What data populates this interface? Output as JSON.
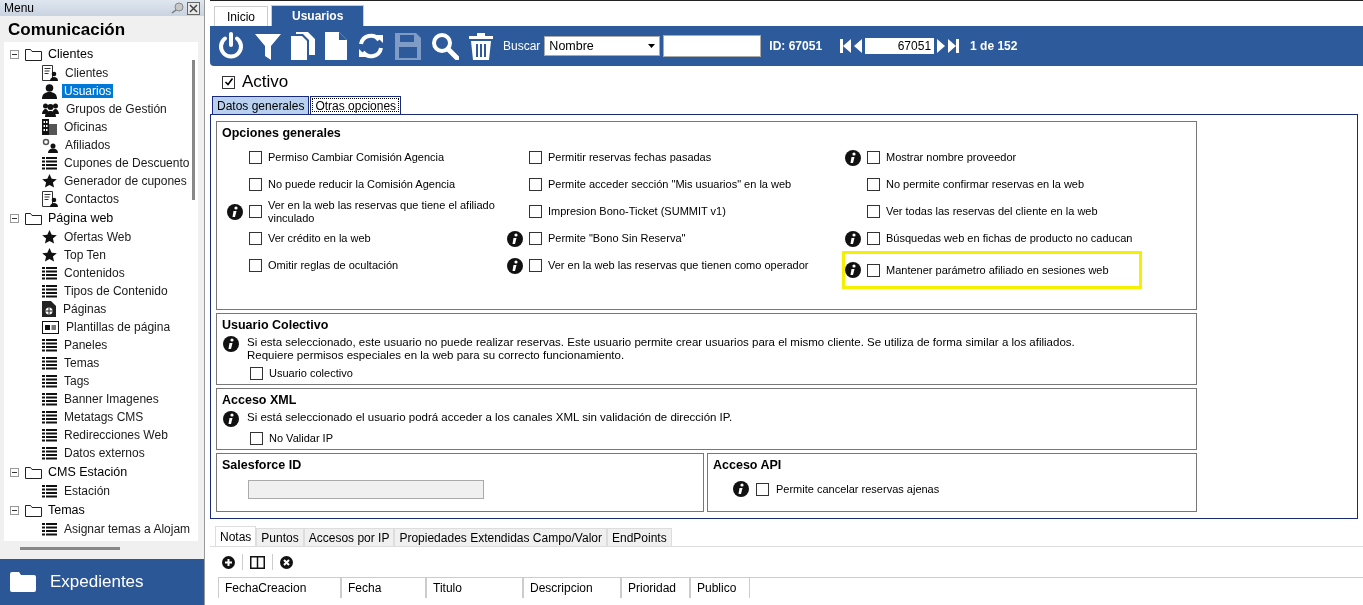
{
  "sidebar": {
    "header": "Menu",
    "title": "Comunicación",
    "tree": [
      {
        "label": "Clientes",
        "expanded": true,
        "children": [
          {
            "label": "Clientes",
            "kind": "contact",
            "selected": false
          },
          {
            "label": "Usuarios",
            "kind": "user",
            "selected": true
          },
          {
            "label": "Grupos de Gestión",
            "kind": "group",
            "selected": false
          },
          {
            "label": "Oficinas",
            "kind": "building",
            "selected": false
          },
          {
            "label": "Afiliados",
            "kind": "affiliate",
            "selected": false
          },
          {
            "label": "Cupones de Descuento",
            "kind": "list",
            "selected": false
          },
          {
            "label": "Generador de cupones",
            "kind": "star",
            "selected": false
          },
          {
            "label": "Contactos",
            "kind": "contact",
            "selected": false
          }
        ]
      },
      {
        "label": "Página web",
        "expanded": true,
        "children": [
          {
            "label": "Ofertas Web",
            "kind": "star",
            "selected": false
          },
          {
            "label": "Top Ten",
            "kind": "star",
            "selected": false
          },
          {
            "label": "Contenidos",
            "kind": "list",
            "selected": false
          },
          {
            "label": "Tipos de Contenido",
            "kind": "list",
            "selected": false
          },
          {
            "label": "Páginas",
            "kind": "page",
            "selected": false
          },
          {
            "label": "Plantillas de página",
            "kind": "template",
            "selected": false
          },
          {
            "label": "Paneles",
            "kind": "list",
            "selected": false
          },
          {
            "label": "Temas",
            "kind": "list",
            "selected": false
          },
          {
            "label": "Tags",
            "kind": "list",
            "selected": false
          },
          {
            "label": "Banner Imagenes",
            "kind": "list",
            "selected": false
          },
          {
            "label": "Metatags CMS",
            "kind": "list",
            "selected": false
          },
          {
            "label": "Redirecciones Web",
            "kind": "list",
            "selected": false
          },
          {
            "label": "Datos externos",
            "kind": "list",
            "selected": false
          }
        ]
      },
      {
        "label": "CMS Estación",
        "expanded": true,
        "children": [
          {
            "label": "Estación",
            "kind": "list",
            "selected": false
          }
        ]
      },
      {
        "label": "Temas",
        "expanded": true,
        "children": [
          {
            "label": "Asignar temas a Alojam",
            "kind": "list",
            "selected": false
          }
        ]
      }
    ],
    "footer": "Expedientes"
  },
  "tabs": [
    {
      "label": "Inicio",
      "selected": false
    },
    {
      "label": "Usuarios",
      "selected": true
    }
  ],
  "toolbar": {
    "buttons": [
      {
        "kind": "power",
        "disabled": false
      },
      {
        "kind": "filter",
        "disabled": false
      },
      {
        "kind": "copy",
        "disabled": false
      },
      {
        "kind": "new",
        "disabled": false
      },
      {
        "kind": "refresh",
        "disabled": false
      },
      {
        "kind": "save",
        "disabled": true
      },
      {
        "kind": "search",
        "disabled": false
      },
      {
        "kind": "delete",
        "disabled": false
      }
    ],
    "search_label": "Buscar",
    "search_by": "Nombre",
    "id_label": "ID: 67051",
    "record": "67051",
    "record_count": "1 de 152"
  },
  "active": {
    "label": "Activo",
    "checked": true
  },
  "subtabs": [
    {
      "label": "Datos generales",
      "selected": false
    },
    {
      "label": "Otras opciones",
      "selected": true
    }
  ],
  "general_options": {
    "title": "Opciones generales",
    "columns": [
      [
        {
          "label": "Permiso Cambiar Comisión Agencia",
          "checked": false,
          "info": false,
          "highlighted": false
        },
        {
          "label": "No puede reducir la Comisión Agencia",
          "checked": false,
          "info": false,
          "highlighted": false
        },
        {
          "label": "Ver en la web las reservas que tiene el afiliado vinculado",
          "checked": false,
          "info": true,
          "highlighted": false
        },
        {
          "label": "Ver crédito en la web",
          "checked": false,
          "info": false,
          "highlighted": false
        },
        {
          "label": "Omitir reglas de ocultación",
          "checked": false,
          "info": false,
          "highlighted": false
        }
      ],
      [
        {
          "label": "Permitir reservas fechas pasadas",
          "checked": false,
          "info": false,
          "highlighted": false
        },
        {
          "label": "Permite acceder sección \"Mis usuarios\" en la web",
          "checked": false,
          "info": false,
          "highlighted": false
        },
        {
          "label": "Impresion Bono-Ticket (SUMMIT v1)",
          "checked": false,
          "info": false,
          "highlighted": false
        },
        {
          "label": "Permite \"Bono Sin Reserva\"",
          "checked": false,
          "info": true,
          "highlighted": false
        },
        {
          "label": "Ver en la web las reservas que tienen como operador",
          "checked": false,
          "info": true,
          "highlighted": false
        }
      ],
      [
        {
          "label": "Mostrar nombre proveedor",
          "checked": false,
          "info": true,
          "highlighted": false
        },
        {
          "label": "No permite confirmar reservas en la web",
          "checked": false,
          "info": false,
          "highlighted": false
        },
        {
          "label": "Ver todas las reservas del cliente en la web",
          "checked": false,
          "info": false,
          "highlighted": false
        },
        {
          "label": "Búsquedas web en fichas de producto no caducan",
          "checked": false,
          "info": true,
          "highlighted": false
        },
        {
          "label": "Mantener parámetro afiliado en sesiones web",
          "checked": false,
          "info": true,
          "highlighted": true
        }
      ]
    ]
  },
  "collective_user": {
    "title": "Usuario Colectivo",
    "notes": [
      "Si esta seleccionado, este usuario no puede realizar reservas. Este usuario permite crear usuarios para el mismo cliente. Se utiliza de forma similar a los afiliados.",
      "Requiere permisos especiales en la web para su correcto funcionamiento."
    ],
    "option": {
      "label": "Usuario colectivo",
      "checked": false
    }
  },
  "xml_access": {
    "title": "Acceso XML",
    "note": "Si está seleccionado el usuario podrá acceder a los canales XML sin validación de dirección IP.",
    "option": {
      "label": "No Validar IP",
      "checked": false
    }
  },
  "salesforce": {
    "title": "Salesforce ID"
  },
  "api_access": {
    "title": "Acceso API",
    "option": {
      "label": "Permite cancelar reservas ajenas",
      "checked": false
    }
  },
  "bottom_tabs": [
    {
      "label": "Notas",
      "selected": true
    },
    {
      "label": "Puntos",
      "selected": false
    },
    {
      "label": "Accesos por IP",
      "selected": false
    },
    {
      "label": "Propiedades Extendidas Campo/Valor",
      "selected": false
    },
    {
      "label": "EndPoints",
      "selected": false
    }
  ],
  "notes_table": {
    "columns": [
      "FechaCreacion",
      "Fecha",
      "Titulo",
      "Descripcion",
      "Prioridad",
      "Publico"
    ]
  }
}
